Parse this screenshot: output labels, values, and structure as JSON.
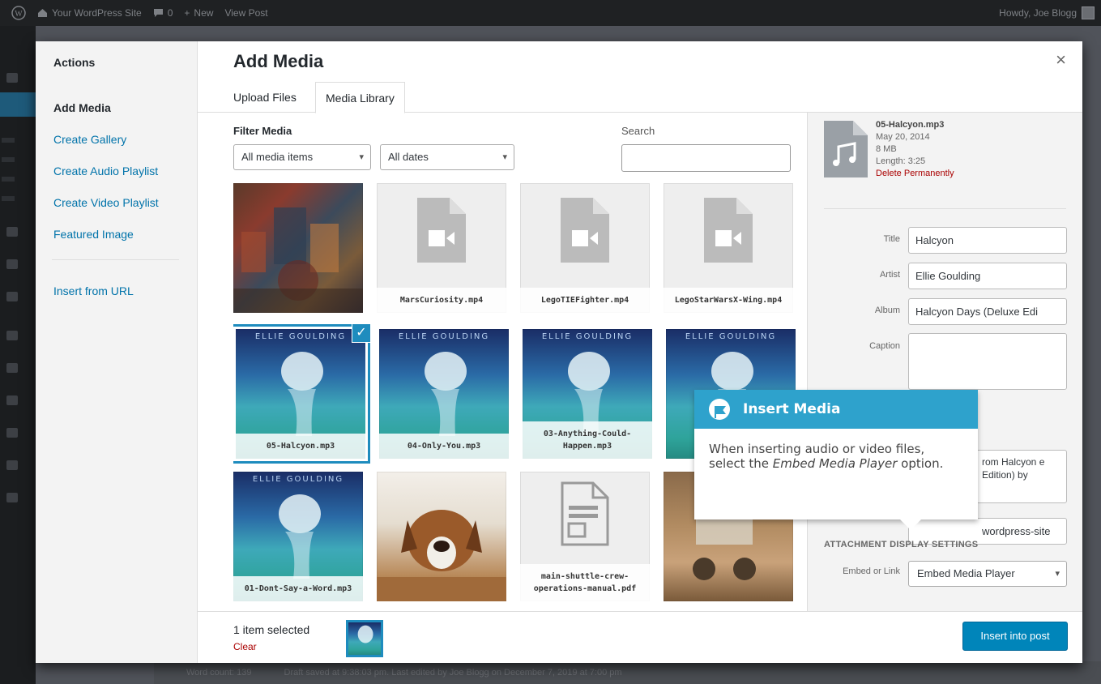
{
  "adminbar": {
    "site_name": "Your WordPress Site",
    "comments_count": "0",
    "new_label": "New",
    "view_post": "View Post",
    "howdy": "Howdy, Joe Blogg"
  },
  "footer": {
    "word_count": "Word count: 139",
    "draft_status": "Draft saved at 9:38:03 pm. Last edited by Joe Blogg on December 7, 2019 at 7:00 pm"
  },
  "menu": {
    "heading": "Actions",
    "items": [
      {
        "label": "Add Media"
      },
      {
        "label": "Create Gallery"
      },
      {
        "label": "Create Audio Playlist"
      },
      {
        "label": "Create Video Playlist"
      },
      {
        "label": "Featured Image"
      }
    ],
    "insert_from_url": "Insert from URL"
  },
  "modal": {
    "title": "Add Media",
    "close": "×",
    "tabs": [
      {
        "label": "Upload Files"
      },
      {
        "label": "Media Library"
      }
    ]
  },
  "toolbar": {
    "filter_label": "Filter Media",
    "media_type": "All media items",
    "dates": "All dates",
    "search_label": "Search",
    "search_value": ""
  },
  "grid": {
    "items": [
      {
        "caption": ""
      },
      {
        "caption": "MarsCuriosity.mp4"
      },
      {
        "caption": "LegoTIEFighter.mp4"
      },
      {
        "caption": "LegoStarWarsX-Wing.mp4"
      },
      {
        "caption": "05-Halcyon.mp3",
        "band": "ELLIE GOULDING"
      },
      {
        "caption": "04-Only-You.mp3",
        "band": "ELLIE GOULDING"
      },
      {
        "caption": "03-Anything-Could-Happen.mp3",
        "band": "ELLIE GOULDING"
      },
      {
        "caption": "",
        "band": "ELLIE GOULDING"
      },
      {
        "caption": "01-Dont-Say-a-Word.mp3",
        "band": "ELLIE GOULDING"
      },
      {
        "caption": ""
      },
      {
        "caption": "main-shuttle-crew-operations-manual.pdf"
      },
      {
        "caption": ""
      }
    ]
  },
  "details": {
    "filename": "05-Halcyon.mp3",
    "date": "May 20, 2014",
    "size": "8 MB",
    "length": "Length: 3:25",
    "delete": "Delete Permanently",
    "title_label": "Title",
    "title_value": "Halcyon",
    "artist_label": "Artist",
    "artist_value": "Ellie Goulding",
    "album_label": "Album",
    "album_value": "Halcyon Days (Deluxe Edi",
    "caption_label": "Caption",
    "caption_value": "",
    "description_value": "rom Halcyon e Edition) by",
    "url_value": "wordpress-site",
    "display_settings_heading": "ATTACHMENT DISPLAY SETTINGS",
    "embed_label": "Embed or Link",
    "embed_value": "Embed Media Player"
  },
  "bottom": {
    "selected_count": "1 item selected",
    "clear": "Clear",
    "insert_button": "Insert into post"
  },
  "pointer": {
    "title": "Insert Media",
    "body_start": "When inserting audio or video files, select the ",
    "body_em": "Embed Media Player",
    "body_end": " option."
  },
  "colors": {
    "accent": "#0085ba",
    "selected_border": "#1e8cbe",
    "pointer_header": "#2ea2cc",
    "delete_red": "#aa0000"
  }
}
